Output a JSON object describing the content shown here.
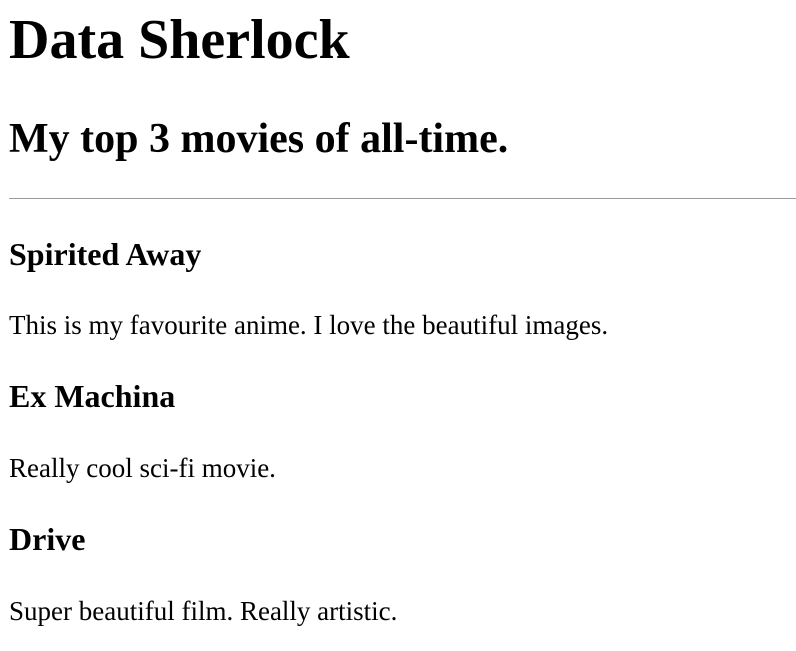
{
  "header": {
    "site_title": "Data Sherlock",
    "subtitle": "My top 3 movies of all-time."
  },
  "movies": [
    {
      "title": "Spirited Away",
      "description": "This is my favourite anime. I love the beautiful images."
    },
    {
      "title": "Ex Machina",
      "description": "Really cool sci-fi movie."
    },
    {
      "title": "Drive",
      "description": "Super beautiful film. Really artistic."
    }
  ],
  "colors": {
    "text": "#000000",
    "background": "#ffffff",
    "divider": "#9a9a9a"
  }
}
